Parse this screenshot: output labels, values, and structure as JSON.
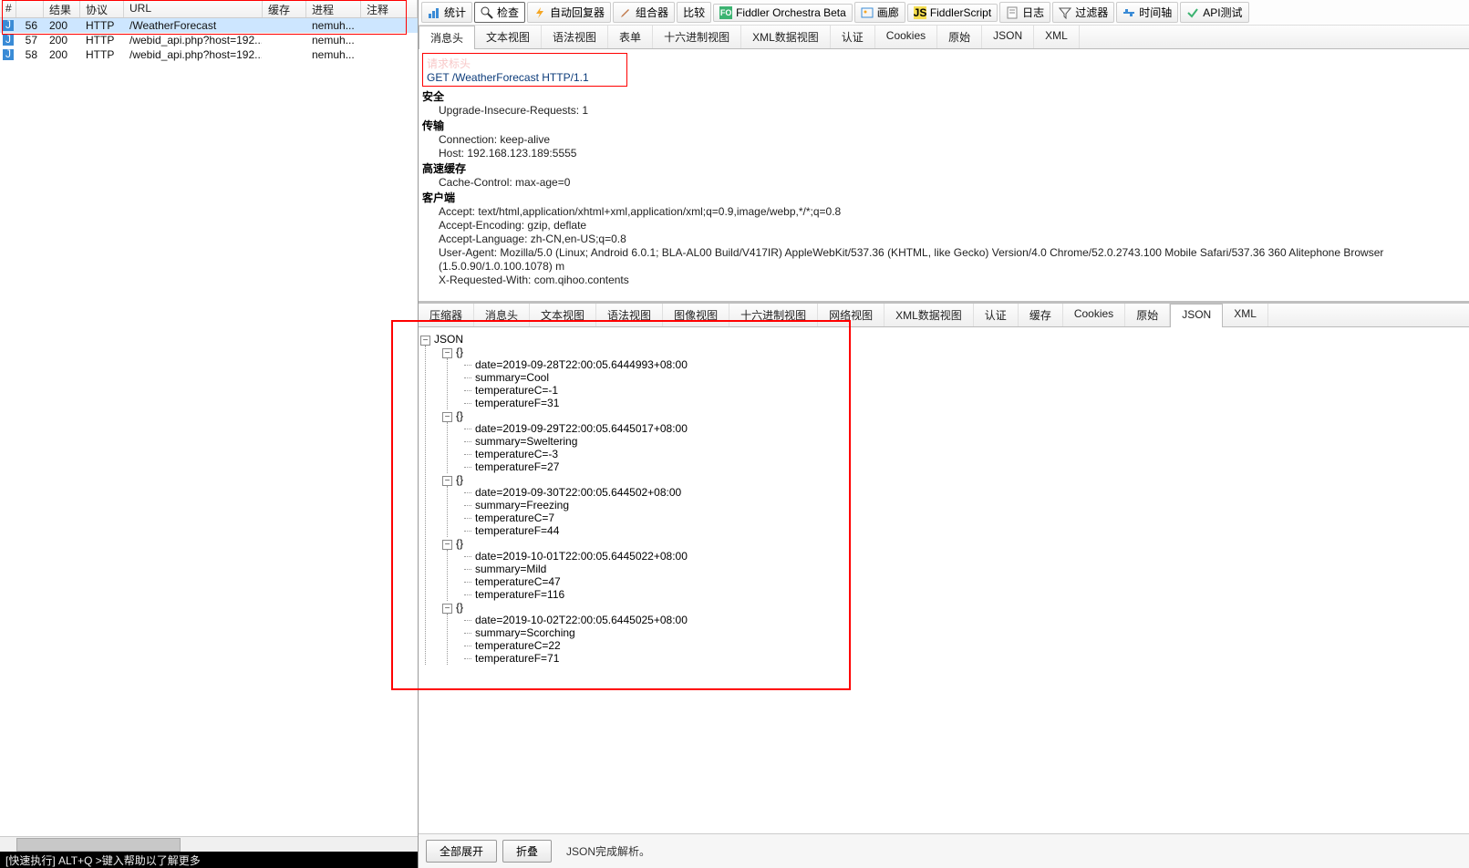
{
  "left": {
    "headers": {
      "hash": "#",
      "result": "结果",
      "proto": "协议",
      "url": "URL",
      "cache": "缓存",
      "proc": "进程",
      "note": "注释"
    },
    "rows": [
      {
        "id": "56",
        "result": "200",
        "proto": "HTTP",
        "url": "/WeatherForecast",
        "proc": "nemuh..."
      },
      {
        "id": "57",
        "result": "200",
        "proto": "HTTP",
        "url": "/webid_api.php?host=192...",
        "proc": "nemuh..."
      },
      {
        "id": "58",
        "result": "200",
        "proto": "HTTP",
        "url": "/webid_api.php?host=192...",
        "proc": "nemuh..."
      }
    ]
  },
  "toolbar": {
    "stats": "统计",
    "inspect": "检查",
    "autoresp": "自动回复器",
    "composer": "组合器",
    "compare": "比较",
    "orchestra": "Fiddler Orchestra Beta",
    "gallery": "画廊",
    "script": "FiddlerScript",
    "log": "日志",
    "filters": "过滤器",
    "timeline": "时间轴",
    "apitest": "API测试"
  },
  "reqTabs": {
    "headers": "消息头",
    "textview": "文本视图",
    "syntax": "语法视图",
    "form": "表单",
    "hex": "十六进制视图",
    "xml": "XML数据视图",
    "auth": "认证",
    "cookies": "Cookies",
    "raw": "原始",
    "json": "JSON",
    "xml2": "XML"
  },
  "request": {
    "ghost": "请求标头",
    "line": "GET /WeatherForecast HTTP/1.1",
    "sections": [
      {
        "title": "安全",
        "items": [
          "Upgrade-Insecure-Requests: 1"
        ]
      },
      {
        "title": "传输",
        "items": [
          "Connection: keep-alive",
          "Host: 192.168.123.189:5555"
        ]
      },
      {
        "title": "高速缓存",
        "items": [
          "Cache-Control: max-age=0"
        ]
      },
      {
        "title": "客户端",
        "items": [
          "Accept: text/html,application/xhtml+xml,application/xml;q=0.9,image/webp,*/*;q=0.8",
          "Accept-Encoding: gzip, deflate",
          "Accept-Language: zh-CN,en-US;q=0.8",
          "User-Agent: Mozilla/5.0 (Linux; Android 6.0.1; BLA-AL00 Build/V417IR) AppleWebKit/537.36 (KHTML, like Gecko) Version/4.0 Chrome/52.0.2743.100 Mobile Safari/537.36 360 Alitephone Browser (1.5.0.90/1.0.100.1078) m",
          "X-Requested-With: com.qihoo.contents"
        ]
      }
    ]
  },
  "respTabs": {
    "transformer": "压缩器",
    "headers": "消息头",
    "textview": "文本视图",
    "syntax": "语法视图",
    "imageview": "图像视图",
    "hex": "十六进制视图",
    "webview": "网络视图",
    "xmldata": "XML数据视图",
    "auth": "认证",
    "caching": "缓存",
    "cookies": "Cookies",
    "raw": "原始",
    "json": "JSON",
    "xml": "XML"
  },
  "json_root": "JSON",
  "json_obj": "{}",
  "forecast": [
    {
      "date": "date=2019-09-28T22:00:05.6444993+08:00",
      "summary": "summary=Cool",
      "tc": "temperatureC=-1",
      "tf": "temperatureF=31"
    },
    {
      "date": "date=2019-09-29T22:00:05.6445017+08:00",
      "summary": "summary=Sweltering",
      "tc": "temperatureC=-3",
      "tf": "temperatureF=27"
    },
    {
      "date": "date=2019-09-30T22:00:05.644502+08:00",
      "summary": "summary=Freezing",
      "tc": "temperatureC=7",
      "tf": "temperatureF=44"
    },
    {
      "date": "date=2019-10-01T22:00:05.6445022+08:00",
      "summary": "summary=Mild",
      "tc": "temperatureC=47",
      "tf": "temperatureF=116"
    },
    {
      "date": "date=2019-10-02T22:00:05.6445025+08:00",
      "summary": "summary=Scorching",
      "tc": "temperatureC=22",
      "tf": "temperatureF=71"
    }
  ],
  "bottom": {
    "expand": "全部展开",
    "collapse": "折叠",
    "status": "JSON完成解析。"
  },
  "quickexec": {
    "hint": "[快速执行] ALT+Q >键入帮助以了解更多"
  }
}
